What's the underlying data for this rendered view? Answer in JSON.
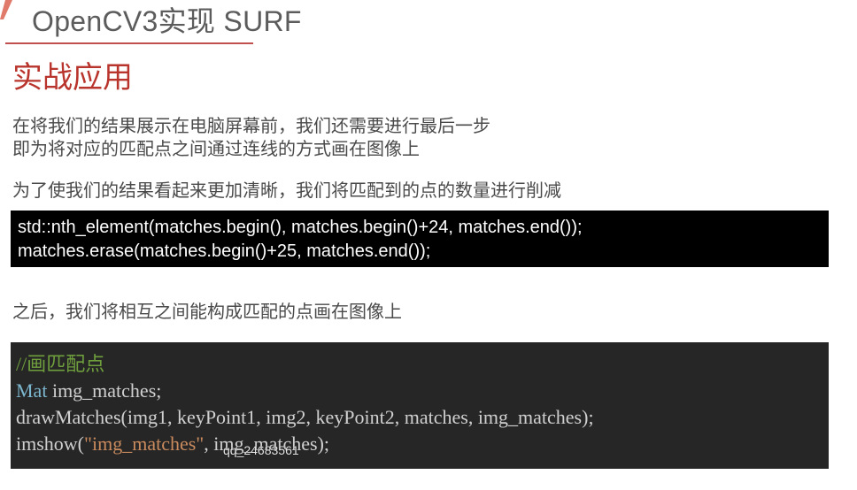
{
  "header": {
    "title": "OpenCV3实现 SURF"
  },
  "section": {
    "title": "实战应用"
  },
  "paragraphs": {
    "intro_line1": "在将我们的结果展示在电脑屏幕前，我们还需要进行最后一步",
    "intro_line2": "即为将对应的匹配点之间通过连线的方式画在图像上",
    "reduce": "为了使我们的结果看起来更加清晰，我们将匹配到的点的数量进行削减",
    "after": "之后，我们将相互之间能构成匹配的点画在图像上"
  },
  "code1": {
    "line1": "std::nth_element(matches.begin(), matches.begin()+24, matches.end());",
    "line2": "matches.erase(matches.begin()+25, matches.end());"
  },
  "code2": {
    "comment": "//画匹配点",
    "line2_type": "Mat",
    "line2_rest": " img_matches;",
    "line3": "drawMatches(img1, keyPoint1, img2, keyPoint2, matches, img_matches);",
    "line4_start": "imshow(",
    "line4_string": "\"img_matches\"",
    "line4_rest": ", img_matches);"
  },
  "watermark": {
    "text": "qq_24683561"
  },
  "colors": {
    "accent": "#c0504d",
    "section_title": "#b8342c",
    "code_comment": "#6f9f3d",
    "code_type": "#7cb7cf",
    "code_string": "#c98b5e"
  }
}
